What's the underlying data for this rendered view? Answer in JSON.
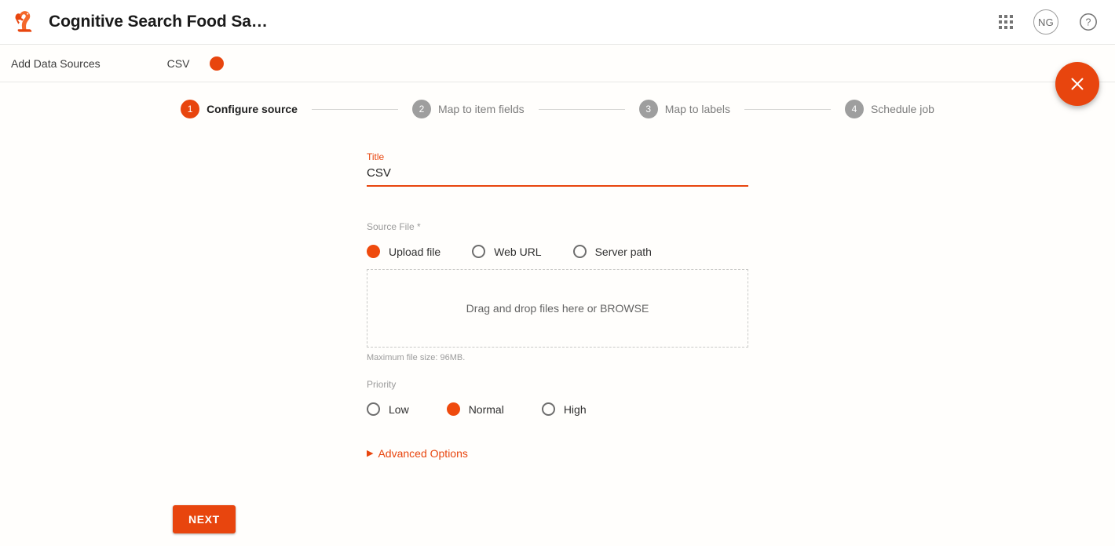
{
  "appbar": {
    "logo_icon": "squirrel-logo-icon",
    "title": "Cognitive Search Food Sa…",
    "apps_icon": "apps-grid-icon",
    "avatar_initials": "NG",
    "help_icon": "help-circle-icon"
  },
  "subbar": {
    "title": "Add Data Sources",
    "breadcrumb": "CSV",
    "status_dot_color": "#e8450e"
  },
  "close_button": {
    "icon": "close-x-icon",
    "color": "#e8450e"
  },
  "stepper": {
    "steps": [
      {
        "num": "1",
        "label": "Configure source",
        "active": true
      },
      {
        "num": "2",
        "label": "Map to item fields",
        "active": false
      },
      {
        "num": "3",
        "label": "Map to labels",
        "active": false
      },
      {
        "num": "4",
        "label": "Schedule job",
        "active": false
      }
    ]
  },
  "form": {
    "title_field": {
      "label": "Title",
      "value": "CSV",
      "placeholder": "Title"
    },
    "source_file": {
      "label": "Source File *",
      "options": [
        {
          "label": "Upload file",
          "selected": true
        },
        {
          "label": "Web URL",
          "selected": false
        },
        {
          "label": "Server path",
          "selected": false
        }
      ]
    },
    "dropzone": {
      "text": "Drag and drop files here or BROWSE",
      "hint": "Maximum file size: 96MB."
    },
    "priority": {
      "label": "Priority",
      "options": [
        {
          "label": "Low",
          "selected": false
        },
        {
          "label": "Normal",
          "selected": true
        },
        {
          "label": "High",
          "selected": false
        }
      ]
    },
    "advanced_options": {
      "caret": "▶",
      "label": "Advanced Options"
    }
  },
  "footer": {
    "next_label": "NEXT"
  },
  "colors": {
    "accent": "#e8450e",
    "radio_selected": "#ef4a0d",
    "muted_text": "#9b9b9b",
    "step_inactive": "#9e9e9e"
  }
}
